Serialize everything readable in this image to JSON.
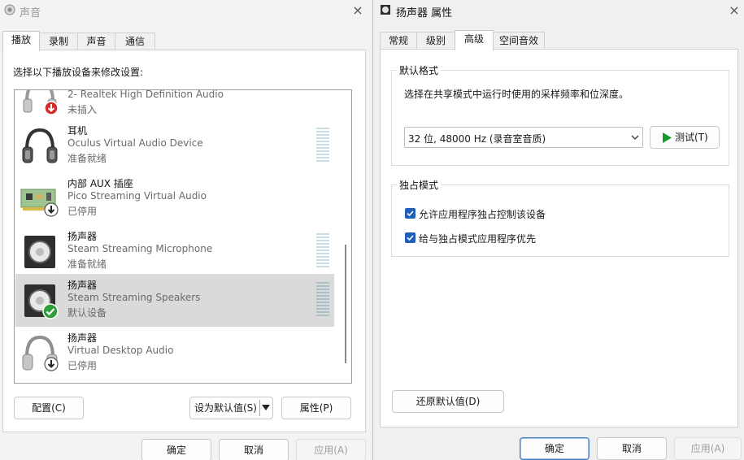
{
  "sound_window": {
    "title": "声音",
    "close_glyph": "×",
    "tabs": [
      "播放",
      "录制",
      "声音",
      "通信"
    ],
    "active_tab": "播放",
    "instruction": "选择以下播放设备来修改设置:",
    "devices": [
      {
        "name": "",
        "desc": "2- Realtek High Definition Audio",
        "status": "未插入",
        "icon": "headphones-icon",
        "badge": "red-arrow-down",
        "selected": false
      },
      {
        "name": "耳机",
        "desc": "Oculus Virtual Audio Device",
        "status": "准备就绪",
        "icon": "headphones-icon",
        "badge": "",
        "selected": false
      },
      {
        "name": "内部 AUX 插座",
        "desc": "Pico Streaming Virtual Audio",
        "status": "已停用",
        "icon": "sound-card-icon",
        "badge": "gray-arrow-down",
        "selected": false
      },
      {
        "name": "扬声器",
        "desc": "Steam Streaming Microphone",
        "status": "准备就绪",
        "icon": "speaker-icon",
        "badge": "",
        "selected": false
      },
      {
        "name": "扬声器",
        "desc": "Steam Streaming Speakers",
        "status": "默认设备",
        "icon": "speaker-icon",
        "badge": "green-check",
        "selected": true
      },
      {
        "name": "扬声器",
        "desc": "Virtual Desktop Audio",
        "status": "已停用",
        "icon": "headphones-icon",
        "badge": "gray-arrow-down",
        "selected": false
      }
    ],
    "buttons": {
      "configure": "配置(C)",
      "set_default": "设为默认值(S)",
      "properties": "属性(P)",
      "ok": "确定",
      "cancel": "取消",
      "apply": "应用(A)"
    }
  },
  "props_window": {
    "title": "扬声器 属性",
    "close_glyph": "×",
    "tabs": [
      "常规",
      "级别",
      "高级",
      "空间音效"
    ],
    "active_tab": "高级",
    "default_format": {
      "title": "默认格式",
      "description": "选择在共享模式中运行时使用的采样频率和位深度。",
      "selected_format": "32 位, 48000 Hz (录音室音质)",
      "test_button": "测试(T)"
    },
    "exclusive": {
      "title": "独占模式",
      "options": [
        {
          "label": "允许应用程序独占控制该设备",
          "checked": true
        },
        {
          "label": "给与独占模式应用程序优先",
          "checked": true
        }
      ]
    },
    "restore_button": "还原默认值(D)",
    "buttons": {
      "ok": "确定",
      "cancel": "取消",
      "apply": "应用(A)"
    }
  },
  "colors": {
    "accent": "#1f5fb8",
    "play_green": "#1a9a2a",
    "ok_green": "#2e9e3a",
    "error_red": "#d42a2a"
  }
}
